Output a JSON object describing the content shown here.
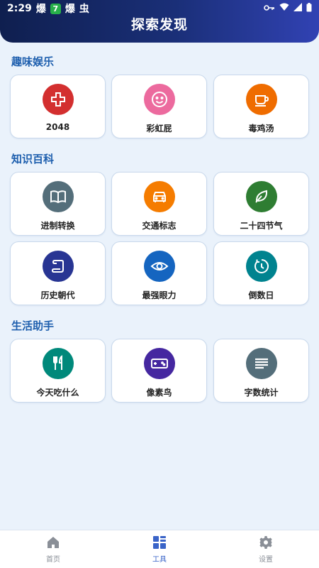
{
  "status_bar": {
    "time": "2:29",
    "app_text_1": "爆",
    "badge": "7",
    "app_text_2": "爆",
    "app_text_3": "虫"
  },
  "header": {
    "title": "探索发现"
  },
  "sections": [
    {
      "title": "趣味娱乐",
      "items": [
        {
          "label": "2048",
          "icon": "puzzle-icon",
          "color": "#d32f2f"
        },
        {
          "label": "彩虹屁",
          "icon": "smile-face-icon",
          "color": "#ec6a9e"
        },
        {
          "label": "毒鸡汤",
          "icon": "coffee-cup-icon",
          "color": "#ef6c00"
        }
      ]
    },
    {
      "title": "知识百科",
      "items": [
        {
          "label": "进制转换",
          "icon": "book-icon",
          "color": "#546e7a"
        },
        {
          "label": "交通标志",
          "icon": "car-icon",
          "color": "#f57c00"
        },
        {
          "label": "二十四节气",
          "icon": "leaf-icon",
          "color": "#2e7d32"
        },
        {
          "label": "历史朝代",
          "icon": "scroll-icon",
          "color": "#283593"
        },
        {
          "label": "最强眼力",
          "icon": "eye-icon",
          "color": "#1565c0"
        },
        {
          "label": "倒数日",
          "icon": "timer-icon",
          "color": "#00838f"
        }
      ]
    },
    {
      "title": "生活助手",
      "items": [
        {
          "label": "今天吃什么",
          "icon": "fork-knife-icon",
          "color": "#00897b"
        },
        {
          "label": "像素鸟",
          "icon": "gamepad-icon",
          "color": "#4527a0"
        },
        {
          "label": "字数统计",
          "icon": "text-lines-icon",
          "color": "#546e7a"
        }
      ]
    }
  ],
  "bottom_nav": [
    {
      "label": "首页",
      "icon": "home-icon",
      "active": false
    },
    {
      "label": "工具",
      "icon": "tools-grid-icon",
      "active": true
    },
    {
      "label": "设置",
      "icon": "gear-icon",
      "active": false
    }
  ]
}
